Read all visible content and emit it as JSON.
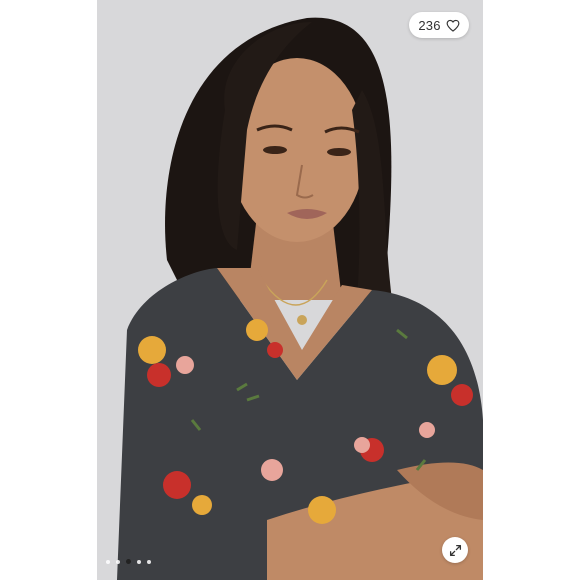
{
  "listing": {
    "like_count": "236",
    "like_icon": "heart-outline-icon",
    "expand_icon": "expand-arrows-icon"
  },
  "carousel": {
    "total": 5,
    "active_index": 2
  },
  "colors": {
    "backdrop": "#d9d9db",
    "dress": "#3d3f43",
    "accent": "#222222"
  }
}
